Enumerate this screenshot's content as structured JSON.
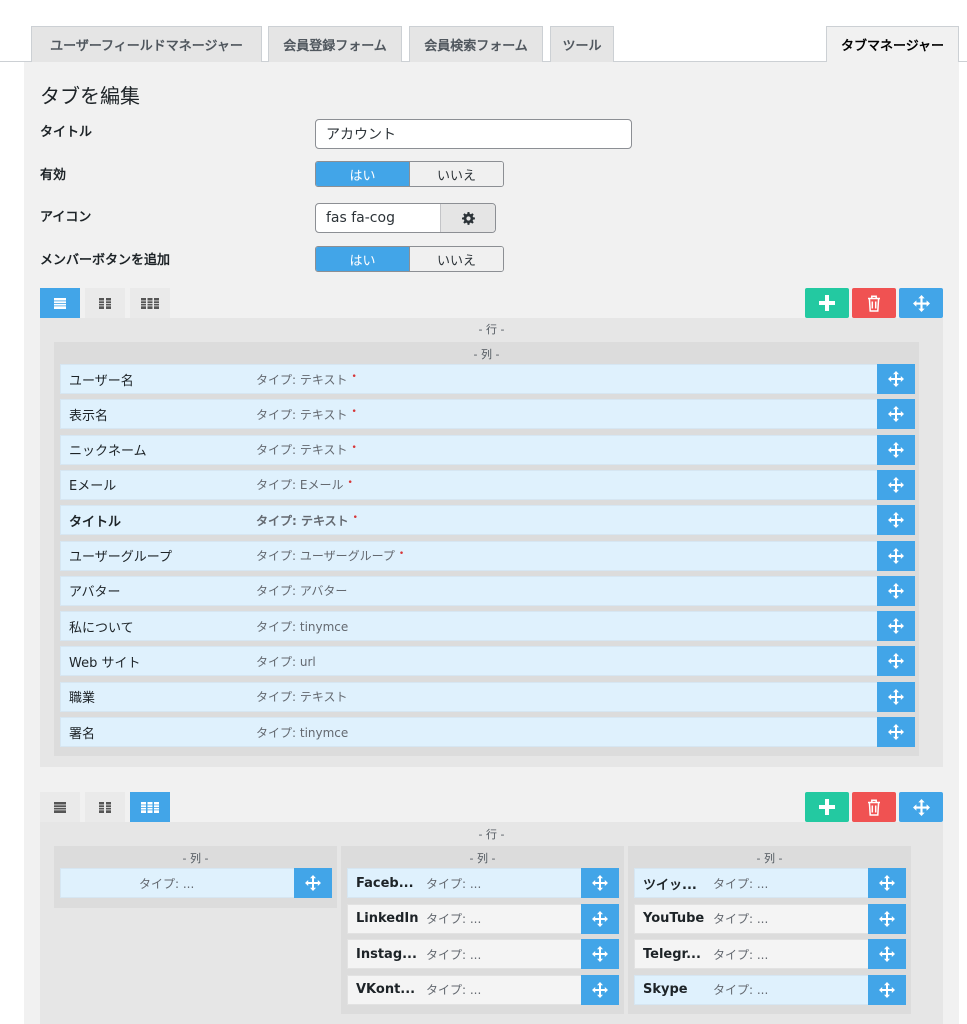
{
  "tabs": [
    {
      "label": "ユーザーフィールドマネージャー"
    },
    {
      "label": "会員登録フォーム"
    },
    {
      "label": "会員検索フォーム"
    },
    {
      "label": "ツール"
    },
    {
      "label": "タブマネージャー"
    }
  ],
  "edit": {
    "heading": "タブを編集",
    "title_label": "タイトル",
    "title_value": "アカウント",
    "enabled_label": "有効",
    "icon_label": "アイコン",
    "icon_value": "fas fa-cog",
    "member_button_label": "メンバーボタンを追加",
    "yes": "はい",
    "no": "いいえ"
  },
  "captions": {
    "row": "- 行 -",
    "col": "- 列 -"
  },
  "section1": {
    "fields": [
      {
        "name": "ユーザー名",
        "type": "タイプ: テキスト",
        "required": true,
        "bold": false
      },
      {
        "name": "表示名",
        "type": "タイプ: テキスト",
        "required": true,
        "bold": false
      },
      {
        "name": "ニックネーム",
        "type": "タイプ: テキスト",
        "required": true,
        "bold": false
      },
      {
        "name": "Eメール",
        "type": "タイプ: Eメール",
        "required": true,
        "bold": false
      },
      {
        "name": "タイトル",
        "type": "タイプ: テキスト",
        "required": true,
        "bold": true
      },
      {
        "name": "ユーザーグループ",
        "type": "タイプ: ユーザーグループ",
        "required": true,
        "bold": false
      },
      {
        "name": "アバター",
        "type": "タイプ: アバター",
        "required": false,
        "bold": false
      },
      {
        "name": "私について",
        "type": "タイプ: tinymce",
        "required": false,
        "bold": false
      },
      {
        "name": "Web サイト",
        "type": "タイプ: url",
        "required": false,
        "bold": false
      },
      {
        "name": "職業",
        "type": "タイプ: テキスト",
        "required": false,
        "bold": false
      },
      {
        "name": "署名",
        "type": "タイプ: tinymce",
        "required": false,
        "bold": false
      }
    ]
  },
  "section2": {
    "col1": [
      {
        "name": "",
        "type": "タイプ: ..."
      }
    ],
    "col2": [
      {
        "name": "Faceb...",
        "type": "タイプ: ..."
      },
      {
        "name": "LinkedIn",
        "type": "タイプ: ..."
      },
      {
        "name": "Instag...",
        "type": "タイプ: ..."
      },
      {
        "name": "VKont...",
        "type": "タイプ: ..."
      }
    ],
    "col3": [
      {
        "name": "ツイッ...",
        "type": "タイプ: ..."
      },
      {
        "name": "YouTube",
        "type": "タイプ: ..."
      },
      {
        "name": "Telegr...",
        "type": "タイプ: ..."
      },
      {
        "name": "Skype",
        "type": "タイプ: ..."
      }
    ]
  },
  "required_mark": "•"
}
